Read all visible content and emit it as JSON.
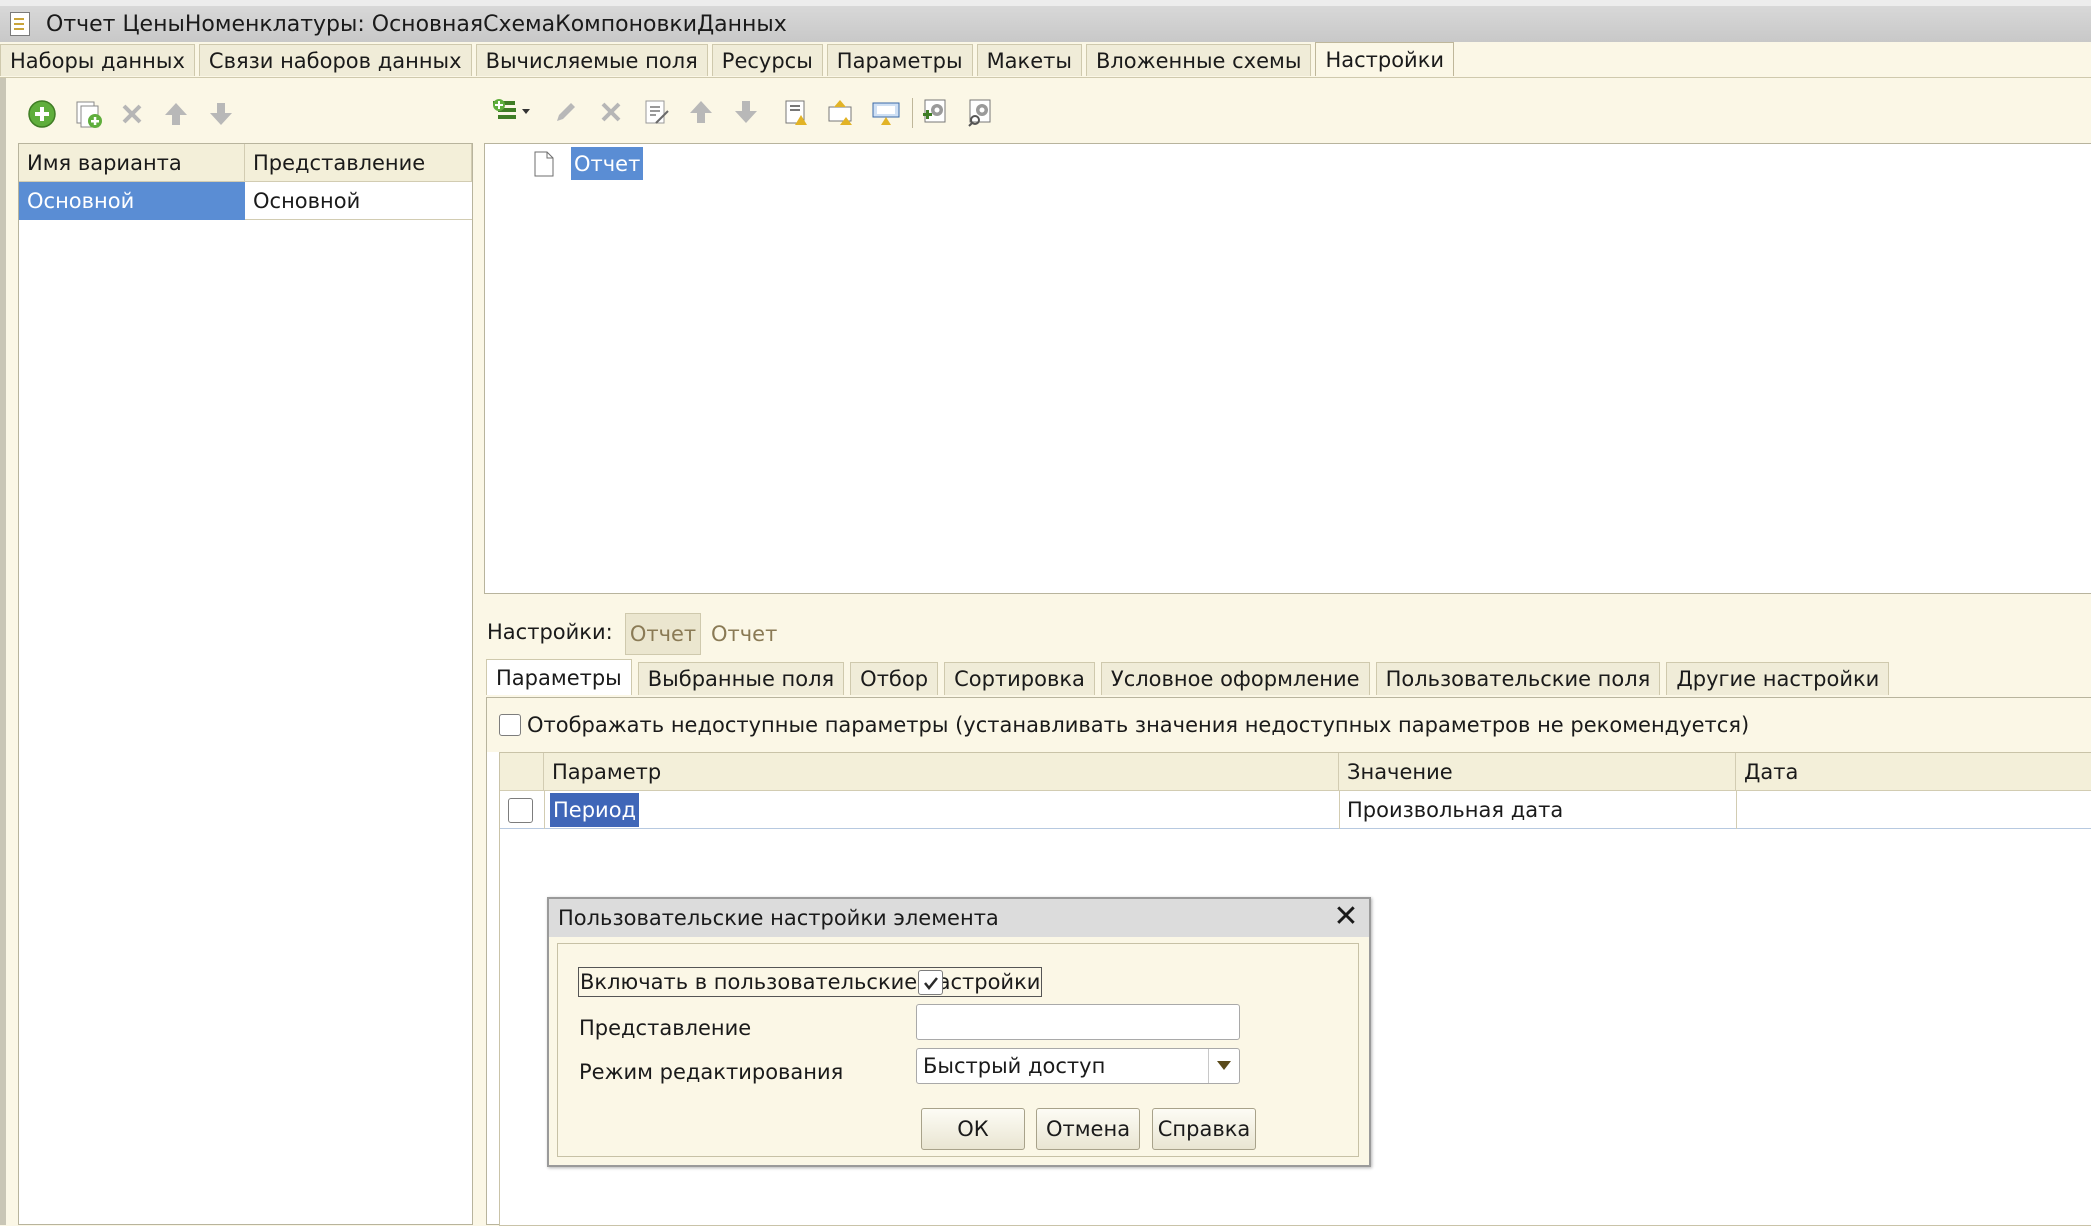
{
  "window": {
    "title": "Отчет ЦеныНоменклатуры: ОсновнаяСхемаКомпоновкиДанных"
  },
  "main_tabs": [
    {
      "label": "Наборы данных"
    },
    {
      "label": "Связи наборов данных"
    },
    {
      "label": "Вычисляемые поля"
    },
    {
      "label": "Ресурсы"
    },
    {
      "label": "Параметры"
    },
    {
      "label": "Макеты"
    },
    {
      "label": "Вложенные схемы"
    },
    {
      "label": "Настройки"
    }
  ],
  "variants": {
    "columns": [
      "Имя варианта",
      "Представление"
    ],
    "rows": [
      {
        "name": "Основной",
        "presentation": "Основной"
      }
    ]
  },
  "structure": {
    "root_label": "Отчет"
  },
  "settings": {
    "label": "Настройки:",
    "current_button": "Отчет",
    "current_text": "Отчет"
  },
  "settings_tabs": [
    {
      "label": "Параметры"
    },
    {
      "label": "Выбранные поля"
    },
    {
      "label": "Отбор"
    },
    {
      "label": "Сортировка"
    },
    {
      "label": "Условное оформление"
    },
    {
      "label": "Пользовательские поля"
    },
    {
      "label": "Другие настройки"
    }
  ],
  "params": {
    "show_unavailable_label": "Отображать недоступные параметры (устанавливать значения недоступных параметров не рекомендуется)",
    "columns": [
      "Параметр",
      "Значение",
      "Дата"
    ],
    "rows": [
      {
        "param": "Период",
        "value": "Произвольная дата",
        "date": ""
      }
    ]
  },
  "dialog": {
    "title": "Пользовательские настройки элемента",
    "include_label": "Включать в пользовательские настройки",
    "include_checked": true,
    "presentation_label": "Представление",
    "presentation_value": "",
    "mode_label": "Режим редактирования",
    "mode_value": "Быстрый доступ",
    "ok": "ОК",
    "cancel": "Отмена",
    "help": "Справка"
  },
  "colors": {
    "selection": "#5a8dd4",
    "background": "#fbf7e6"
  }
}
